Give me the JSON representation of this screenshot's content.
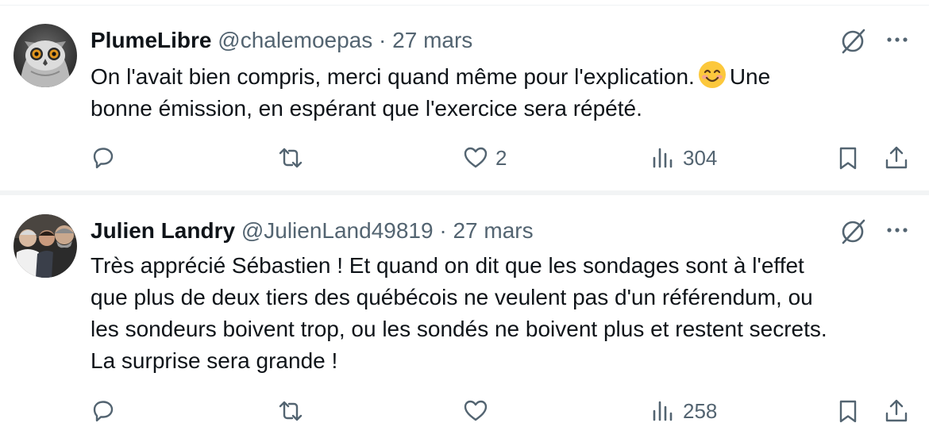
{
  "tweets": [
    {
      "author_name": "PlumeLibre",
      "handle": "@chalemoepas",
      "separator": "·",
      "time": "27 mars",
      "text_line_1_before_emoji": "On l'avait bien compris, merci quand même pour l'explication.",
      "text_line_1_after_emoji": "Une",
      "text_line_2": "bonne émission, en espérant que l'exercice sera répété.",
      "emoji": "smiling-face-with-smiling-eyes",
      "replies": "",
      "retweets": "",
      "likes": "2",
      "views": "304"
    },
    {
      "author_name": "Julien Landry",
      "handle": "@JulienLand49819",
      "separator": "·",
      "time": "27 mars",
      "text_lines": [
        "Très apprécié Sébastien ! Et quand on dit que les sondages sont à l'effet",
        "que plus de deux tiers des québécois ne veulent pas d'un référendum, ou",
        "les sondeurs boivent trop, ou les sondés ne boivent plus et restent secrets.",
        "La surprise sera grande !"
      ],
      "replies": "",
      "retweets": "",
      "likes": "",
      "views": "258"
    }
  ],
  "icons": {
    "grok": "grok-icon",
    "more": "more-icon",
    "reply": "reply-icon",
    "retweet": "retweet-icon",
    "like": "heart-icon",
    "views": "views-icon",
    "bookmark": "bookmark-icon",
    "share": "share-icon"
  },
  "colors": {
    "text_primary": "#0f1419",
    "text_secondary": "#536471",
    "separator": "#eff3f4"
  }
}
